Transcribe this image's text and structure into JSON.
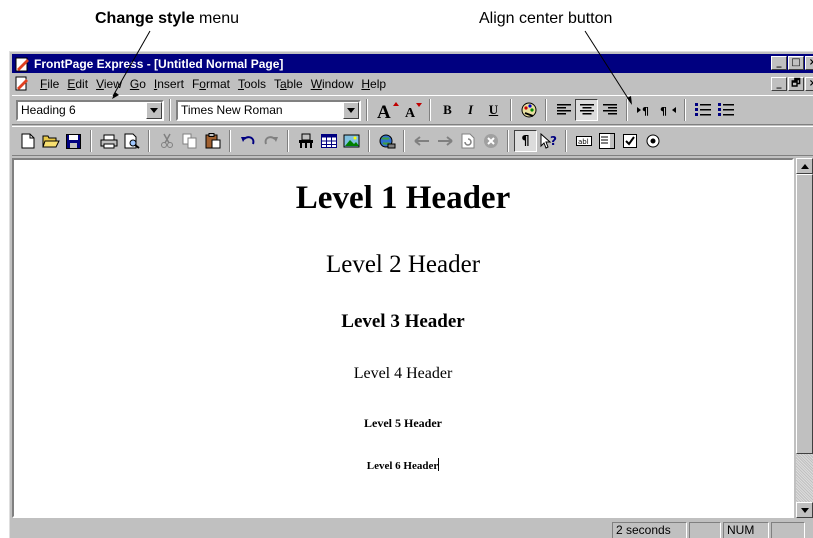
{
  "callouts": {
    "change_style_bold": "Change style",
    "change_style_rest": " menu",
    "align_center": "Align center button"
  },
  "window": {
    "title": "FrontPage Express - [Untitled Normal Page]",
    "title_buttons": [
      "_",
      "□",
      "×"
    ],
    "mdi_buttons": [
      "_",
      "🗗",
      "×"
    ]
  },
  "menu": {
    "items": [
      {
        "label": "File",
        "accel": "F"
      },
      {
        "label": "Edit",
        "accel": "E"
      },
      {
        "label": "View",
        "accel": "V"
      },
      {
        "label": "Go",
        "accel": "G"
      },
      {
        "label": "Insert",
        "accel": "I"
      },
      {
        "label": "Format",
        "accel": "o"
      },
      {
        "label": "Tools",
        "accel": "T"
      },
      {
        "label": "Table",
        "accel": "a"
      },
      {
        "label": "Window",
        "accel": "W"
      },
      {
        "label": "Help",
        "accel": "H"
      }
    ]
  },
  "format_toolbar": {
    "style_value": "Heading 6",
    "font_value": "Times New Roman",
    "bold": "B",
    "italic": "I",
    "underline": "U"
  },
  "document": {
    "h1": "Level 1 Header",
    "h2": "Level 2 Header",
    "h3": "Level 3 Header",
    "h4": "Level 4 Header",
    "h5": "Level 5 Header",
    "h6": "Level 6 Header"
  },
  "statusbar": {
    "time": "2 seconds",
    "num": "NUM"
  },
  "colors": {
    "titlebar": "#000080",
    "face": "#c0c0c0"
  }
}
